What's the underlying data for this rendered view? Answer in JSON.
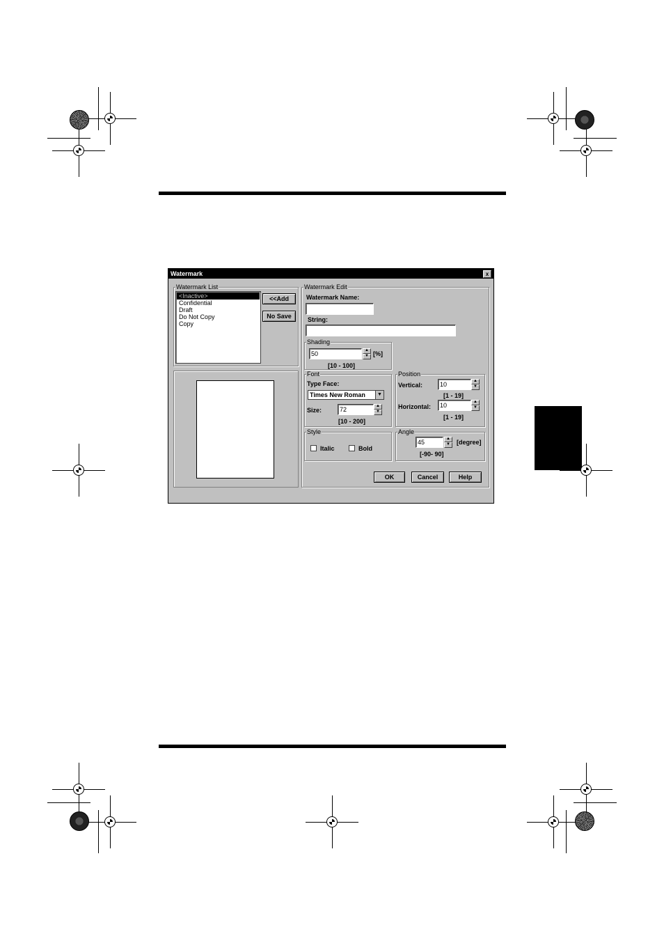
{
  "dialog": {
    "title": "Watermark",
    "close_symbol": "x"
  },
  "watermark_list": {
    "legend": "Watermark List",
    "items": [
      "<Inactive>",
      "Confidential",
      "Draft",
      "Do Not Copy",
      "Copy"
    ],
    "selected_index": 0,
    "add_button": "<<Add",
    "no_save_button": "No Save"
  },
  "watermark_edit": {
    "legend": "Watermark Edit",
    "name_label": "Watermark Name:",
    "name_value": "",
    "string_label": "String:",
    "string_value": ""
  },
  "shading": {
    "legend": "Shading",
    "value": "50",
    "unit": "[%]",
    "range": "[10 - 100]"
  },
  "font": {
    "legend": "Font",
    "type_face_label": "Type Face:",
    "type_face_value": "Times New Roman",
    "size_label": "Size:",
    "size_value": "72",
    "size_range": "[10 - 200]"
  },
  "position": {
    "legend": "Position",
    "vertical_label": "Vertical:",
    "vertical_value": "10",
    "vertical_range": "[1 - 19]",
    "horizontal_label": "Horizontal:",
    "horizontal_value": "10",
    "horizontal_range": "[1 - 19]"
  },
  "style": {
    "legend": "Style",
    "italic_label": "Italic",
    "italic_checked": false,
    "bold_label": "Bold",
    "bold_checked": false
  },
  "angle": {
    "legend": "Angle",
    "value": "45",
    "unit": "[degree]",
    "range": "[-90- 90]"
  },
  "buttons": {
    "ok": "OK",
    "cancel": "Cancel",
    "help": "Help"
  },
  "icons": {
    "spin_up": "▲",
    "spin_down": "▼",
    "dropdown": "▼"
  }
}
